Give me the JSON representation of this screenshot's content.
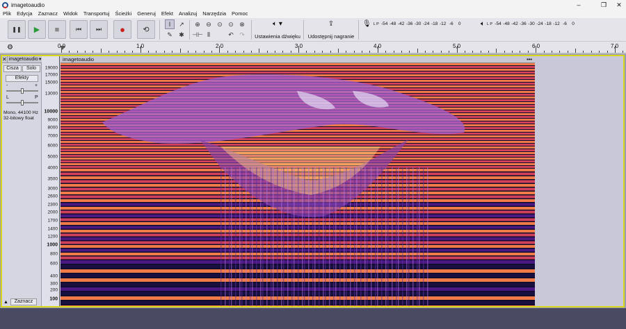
{
  "window": {
    "title": "imagetoaudio",
    "minimize": "–",
    "maximize": "❐",
    "close": "✕"
  },
  "menu": [
    "Plik",
    "Edycja",
    "Zaznacz",
    "Widok",
    "Transportuj",
    "Ścieżki",
    "Generuj",
    "Efekt",
    "Analizuj",
    "Narzędzia",
    "Pomoc"
  ],
  "toolbar": {
    "pause": "❚❚",
    "play": "▶",
    "stop": "■",
    "skip_start": "⏮",
    "skip_end": "⏭",
    "record": "●",
    "loop": "⟲",
    "audio_setup_label": "Ustawienia dźwięku",
    "share_label": "Udostępnij nagranie",
    "record_meter": {
      "channels": "L P",
      "ticks": [
        "-54",
        "-48",
        "-42",
        "-36",
        "-30",
        "-24",
        "-18",
        "-12",
        "-6",
        "0"
      ]
    },
    "play_meter": {
      "channels": "L P",
      "ticks": [
        "-54",
        "-48",
        "-42",
        "-36",
        "-30",
        "-24",
        "-18",
        "-12",
        "-6",
        "0"
      ]
    }
  },
  "ruler": {
    "labels": [
      "0,0",
      "1,0",
      "2,0",
      "3,0",
      "4,0",
      "5,0",
      "6,0",
      "7,0"
    ]
  },
  "track": {
    "name": "imagetoaudio",
    "close": "✕",
    "mute_label": "Cisza",
    "solo_label": "Solo",
    "effects_label": "Efekty",
    "gain_minus": "-",
    "gain_plus": "+",
    "pan_left": "L",
    "pan_right": "P",
    "info_line1": "Mono, 44100 Hz",
    "info_line2": "32-bitowy float",
    "select_label": "Zaznacz",
    "collapse": "▲",
    "clip_name": "imagetoaudio",
    "clip_menu": "•••"
  },
  "freq_scale": [
    {
      "v": "19000",
      "major": false
    },
    {
      "v": "17000",
      "major": false
    },
    {
      "v": "15000",
      "major": false
    },
    {
      "v": "13000",
      "major": false
    },
    {
      "v": "10000",
      "major": true
    },
    {
      "v": "9000",
      "major": false
    },
    {
      "v": "8000",
      "major": false
    },
    {
      "v": "7000",
      "major": false
    },
    {
      "v": "6000",
      "major": false
    },
    {
      "v": "5000",
      "major": false
    },
    {
      "v": "4000",
      "major": false
    },
    {
      "v": "3500",
      "major": false
    },
    {
      "v": "3000",
      "major": false
    },
    {
      "v": "2600",
      "major": false
    },
    {
      "v": "2300",
      "major": false
    },
    {
      "v": "2000",
      "major": false
    },
    {
      "v": "1700",
      "major": false
    },
    {
      "v": "1400",
      "major": false
    },
    {
      "v": "1200",
      "major": false
    },
    {
      "v": "1000",
      "major": true
    },
    {
      "v": "800",
      "major": false
    },
    {
      "v": "600",
      "major": false
    },
    {
      "v": "400",
      "major": false
    },
    {
      "v": "300",
      "major": false
    },
    {
      "v": "200",
      "major": false
    },
    {
      "v": "100",
      "major": true
    }
  ],
  "colors": {
    "spectro_bg": "#0b0b2a",
    "band_hot": "#f07a48",
    "band_mid": "#d0405a",
    "band_cool": "#4a1880",
    "selection_border": "#d8d818"
  }
}
